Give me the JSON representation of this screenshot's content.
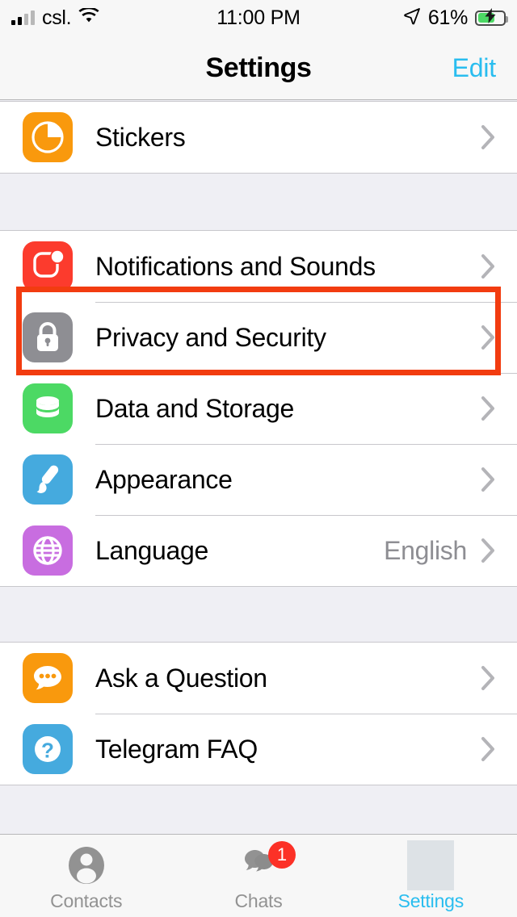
{
  "status_bar": {
    "carrier": "csl.",
    "time": "11:00 PM",
    "battery_percent": "61%",
    "signal_icon": "signal-bars-icon",
    "wifi_icon": "wifi-icon",
    "location_icon": "location-arrow-icon",
    "battery_icon": "battery-charging-icon"
  },
  "nav": {
    "title": "Settings",
    "edit_label": "Edit"
  },
  "groups": [
    {
      "rows": [
        {
          "label": "Stickers",
          "value": "",
          "icon": "stickers-icon",
          "icon_class": "ic-stickers"
        }
      ]
    },
    {
      "rows": [
        {
          "label": "Notifications and Sounds",
          "value": "",
          "icon": "notifications-icon",
          "icon_class": "ic-notif"
        },
        {
          "label": "Privacy and Security",
          "value": "",
          "icon": "lock-icon",
          "icon_class": "ic-privacy"
        },
        {
          "label": "Data and Storage",
          "value": "",
          "icon": "database-icon",
          "icon_class": "ic-data"
        },
        {
          "label": "Appearance",
          "value": "",
          "icon": "paintbrush-icon",
          "icon_class": "ic-appearance"
        },
        {
          "label": "Language",
          "value": "English",
          "icon": "globe-icon",
          "icon_class": "ic-language"
        }
      ]
    },
    {
      "rows": [
        {
          "label": "Ask a Question",
          "value": "",
          "icon": "chat-bubble-dots-icon",
          "icon_class": "ic-ask"
        },
        {
          "label": "Telegram FAQ",
          "value": "",
          "icon": "question-mark-icon",
          "icon_class": "ic-faq"
        }
      ]
    }
  ],
  "highlight": {
    "target_row": "Privacy and Security",
    "color": "#F23C10"
  },
  "tab_bar": {
    "tabs": [
      {
        "label": "Contacts",
        "icon": "person-icon",
        "active": false,
        "badge": ""
      },
      {
        "label": "Chats",
        "icon": "chats-bubbles-icon",
        "active": false,
        "badge": "1"
      },
      {
        "label": "Settings",
        "icon": "settings-placeholder-icon",
        "active": true,
        "badge": ""
      }
    ]
  },
  "colors": {
    "accent": "#29BDEF",
    "badge_red": "#FC3127",
    "highlight_red": "#F23C10",
    "separator": "#C8C7CC",
    "group_bg": "#EFEFF4"
  }
}
